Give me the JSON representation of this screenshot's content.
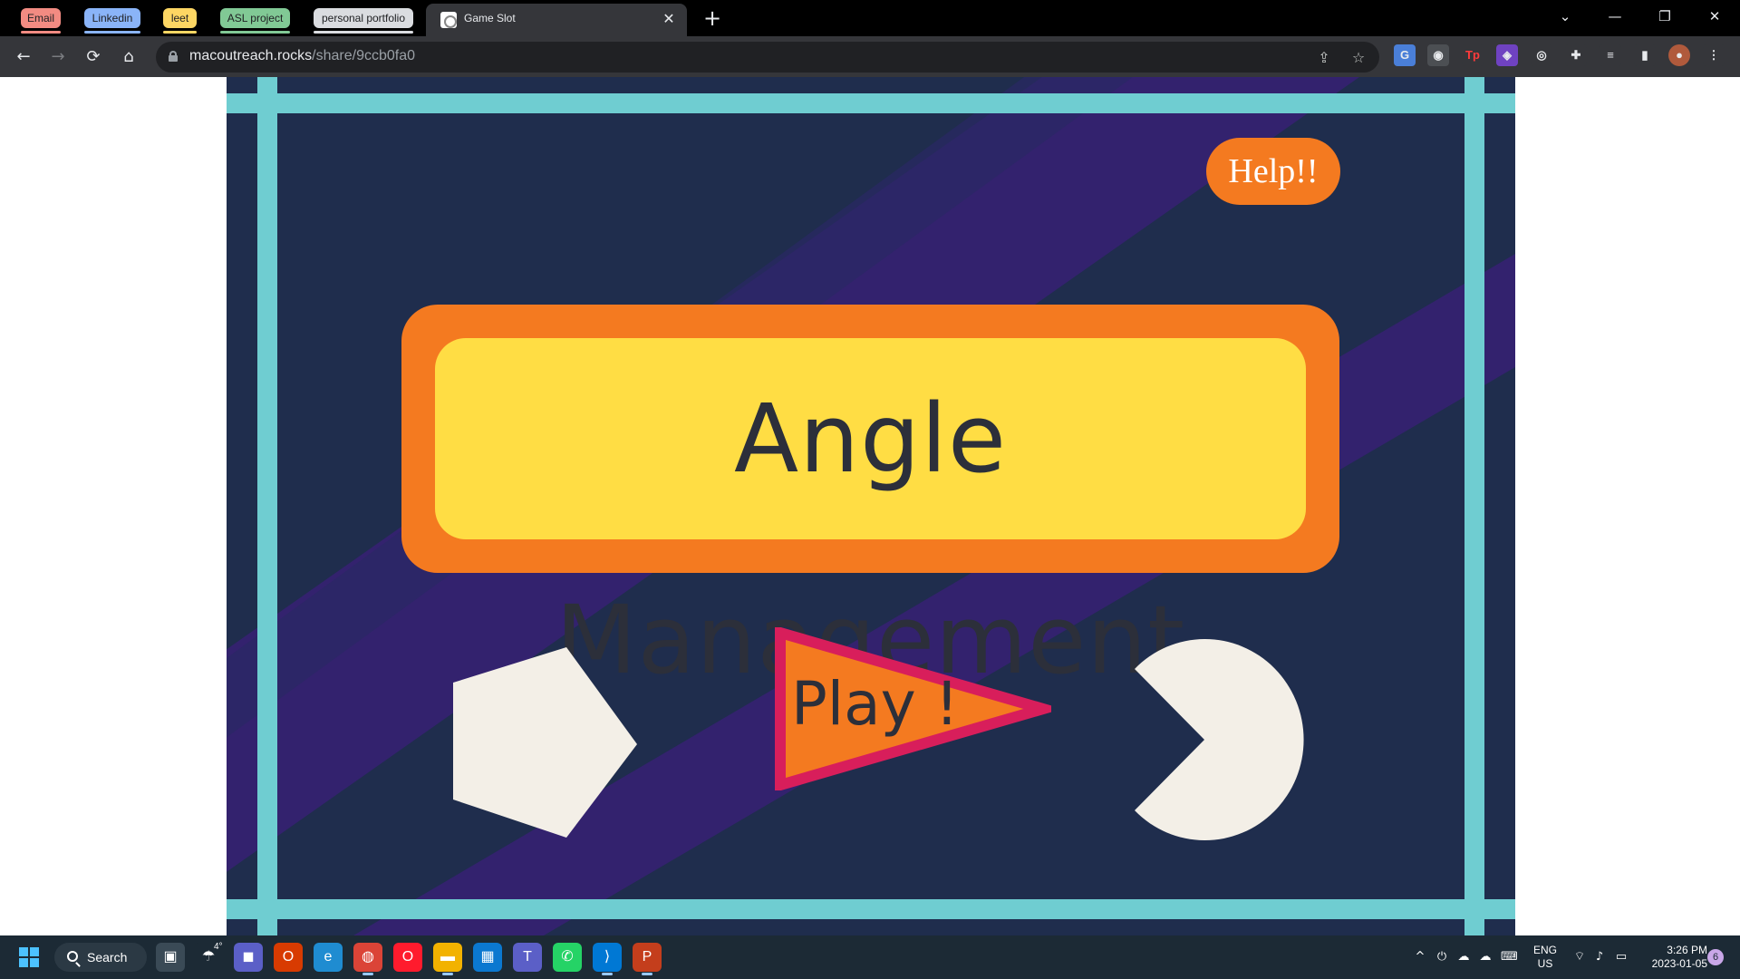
{
  "browser": {
    "tab_groups": [
      {
        "label": "Email",
        "color": "#f28b82"
      },
      {
        "label": "Linkedin",
        "color": "#8ab4f8"
      },
      {
        "label": "leet",
        "color": "#fdd663"
      },
      {
        "label": "ASL project",
        "color": "#81c995"
      },
      {
        "label": "personal portfolio",
        "color": "#dadce0"
      }
    ],
    "active_tab": {
      "title": "Game Slot",
      "close_glyph": "✕"
    },
    "new_tab_glyph": "+",
    "window_controls": {
      "tab_search": "⌄",
      "minimize": "—",
      "restore": "❐",
      "close": "✕"
    },
    "url": {
      "host": "macoutreach.rocks",
      "path": "/share/9ccb0fa0"
    },
    "nav": {
      "back": "←",
      "forward": "→",
      "reload": "⟳",
      "home": "⌂"
    },
    "omnibox_icons": {
      "share": "⇪",
      "bookmark": "☆"
    },
    "extensions": [
      {
        "name": "google-translate-extension-icon",
        "glyph": "G",
        "color": "#4a7fd8"
      },
      {
        "name": "extension-icon-2",
        "glyph": "◉",
        "color": "#4c4f53"
      },
      {
        "name": "tp-extension-icon",
        "glyph": "Tp",
        "color": "#35363a"
      },
      {
        "name": "purple-extension-icon",
        "glyph": "◈",
        "color": "#6f42c1"
      },
      {
        "name": "lightbulb-extension-icon",
        "glyph": "◎",
        "color": "#35363a"
      },
      {
        "name": "puzzle-extensions-icon",
        "glyph": "✚",
        "color": "#35363a"
      },
      {
        "name": "reading-list-icon",
        "glyph": "≡",
        "color": "#35363a"
      },
      {
        "name": "side-panel-icon",
        "glyph": "▮",
        "color": "#35363a"
      },
      {
        "name": "profile-avatar-icon",
        "glyph": "●",
        "color": "#b05a3c"
      },
      {
        "name": "menu-kebab-icon",
        "glyph": "⋮",
        "color": "#35363a"
      }
    ]
  },
  "game": {
    "title": "Angle Management",
    "help_label": "Help!!",
    "play_label": "Play !",
    "colors": {
      "background_navy": "#1f2d4d",
      "stripe_purple": "#33226e",
      "grid_teal": "#6fcdd1",
      "title_orange": "#f47a20",
      "title_yellow": "#ffdd44",
      "shape_cream": "#f3efe7",
      "play_pink": "#d81e5b",
      "text_dark": "#2c2f3a"
    }
  },
  "taskbar": {
    "search_label": "Search",
    "weather_temp": "4°",
    "apps": [
      {
        "name": "task-view-icon",
        "glyph": "▣",
        "color": "#3a4a56"
      },
      {
        "name": "weather-icon",
        "glyph": "☂",
        "color": "#1c2a35"
      },
      {
        "name": "teams-chat-icon",
        "glyph": "◼",
        "color": "#5b5fc7"
      },
      {
        "name": "office-icon",
        "glyph": "O",
        "color": "#d83b01"
      },
      {
        "name": "edge-icon",
        "glyph": "e",
        "color": "#1f8cd1"
      },
      {
        "name": "chrome-icon",
        "glyph": "◍",
        "color": "#db4437"
      },
      {
        "name": "opera-icon",
        "glyph": "O",
        "color": "#ff1b2d"
      },
      {
        "name": "file-explorer-icon",
        "glyph": "▬",
        "color": "#f2b200"
      },
      {
        "name": "store-icon",
        "glyph": "▦",
        "color": "#0b78d0"
      },
      {
        "name": "teams-icon",
        "glyph": "T",
        "color": "#5b5fc7"
      },
      {
        "name": "whatsapp-icon",
        "glyph": "✆",
        "color": "#25d366"
      },
      {
        "name": "vscode-icon",
        "glyph": "⟩",
        "color": "#0078d4"
      },
      {
        "name": "powerpoint-icon",
        "glyph": "P",
        "color": "#c43e1c"
      }
    ],
    "tray": {
      "lang_line1": "ENG",
      "lang_line2": "US",
      "time": "3:26 PM",
      "date": "2023-01-05",
      "notification_count": "6",
      "chevron": "^"
    }
  }
}
